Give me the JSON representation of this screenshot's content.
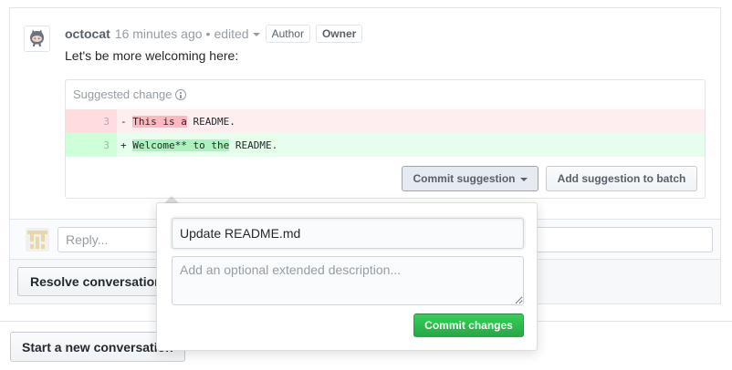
{
  "comment": {
    "author": "octocat",
    "timestamp": "16 minutes ago",
    "bullet": "•",
    "edited_label": "edited",
    "badges": [
      "Author",
      "Owner"
    ],
    "body": "Let's be more welcoming here:"
  },
  "suggestion": {
    "title": "Suggested change",
    "info_icon": "info-icon",
    "deleted_line": {
      "number": "3",
      "prefix": "- ",
      "highlighted": "This is a",
      "rest": " README."
    },
    "added_line": {
      "number": "3",
      "prefix": "+ ",
      "highlighted": "Welcome** to the",
      "rest": " README."
    },
    "commit_button_label": "Commit suggestion",
    "batch_button_label": "Add suggestion to batch"
  },
  "reply": {
    "placeholder": "Reply..."
  },
  "resolve_button_label": "Resolve conversation",
  "start_button_label": "Start a new conversation",
  "commit_popover": {
    "title_value": "Update README.md",
    "description_placeholder": "Add an optional extended description...",
    "commit_button_label": "Commit changes"
  },
  "colors": {
    "deleted_bg": "#ffeef0",
    "added_bg": "#e6ffed",
    "commit_green": "#28a745"
  }
}
